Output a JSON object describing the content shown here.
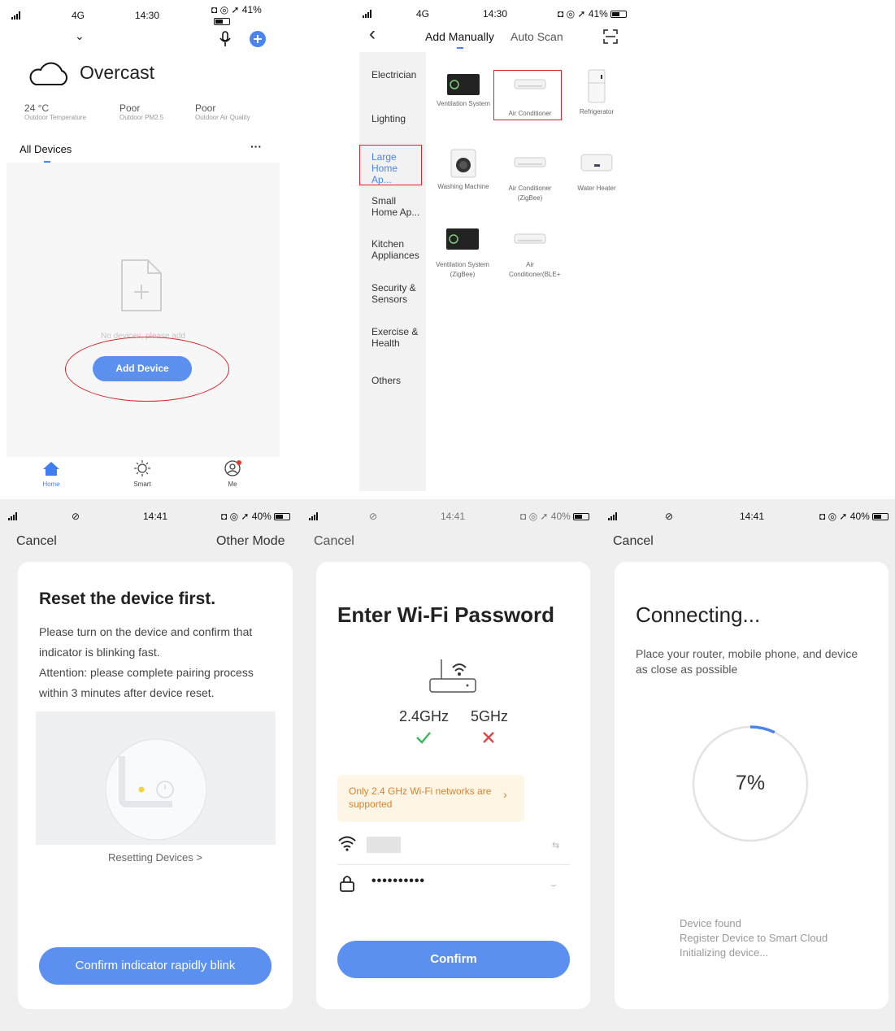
{
  "status": {
    "top_left": {
      "network": "4G",
      "time": "14:30",
      "battery": "41%"
    },
    "top_right": {
      "network": "4G",
      "time": "14:30",
      "battery": "41%"
    },
    "bottom": {
      "time": "14:41",
      "battery": "40%"
    }
  },
  "home": {
    "weather": "Overcast",
    "stats": [
      {
        "value": "24 °C",
        "label": "Outdoor Temperature"
      },
      {
        "value": "Poor",
        "label": "Outdoor PM2.5"
      },
      {
        "value": "Poor",
        "label": "Outdoor Air Quality"
      }
    ],
    "tab": "All Devices",
    "more": "···",
    "empty_text": "No devices, please add",
    "add_button": "Add Device",
    "nav": [
      {
        "label": "Home",
        "icon": "home-icon"
      },
      {
        "label": "Smart",
        "icon": "sun-icon"
      },
      {
        "label": "Me",
        "icon": "profile-icon"
      }
    ],
    "annotation_color": "#d9252b"
  },
  "add_device": {
    "back": "‹",
    "tabs": [
      "Add Manually",
      "Auto Scan"
    ],
    "categories": [
      "Electrician",
      "Lighting",
      "Large Home Ap...",
      "Small Home Ap...",
      "Kitchen Appliances",
      "Security & Sensors",
      "Exercise & Health",
      "Others"
    ],
    "devices": [
      {
        "name": "Ventilation System",
        "icon": "ventilation-icon"
      },
      {
        "name": "Air Conditioner",
        "icon": "air-conditioner-icon"
      },
      {
        "name": "Refrigerator",
        "icon": "refrigerator-icon"
      },
      {
        "name": "Washing Machine",
        "icon": "washing-machine-icon"
      },
      {
        "name": "Air Conditioner (ZigBee)",
        "icon": "air-conditioner-icon"
      },
      {
        "name": "Water Heater",
        "icon": "water-heater-icon"
      },
      {
        "name": "Ventilation System (ZigBee)",
        "icon": "ventilation-icon"
      },
      {
        "name": "Air Conditioner(BLE+",
        "icon": "air-conditioner-icon"
      }
    ]
  },
  "reset": {
    "cancel": "Cancel",
    "other_mode": "Other Mode",
    "title": "Reset the device first.",
    "body1": "Please turn on the device and confirm that indicator is blinking fast.",
    "body2": "Attention: please complete pairing process within 3 minutes after device reset.",
    "link": "Resetting Devices >",
    "button": "Confirm indicator rapidly blink"
  },
  "wifi": {
    "cancel": "Cancel",
    "title": "Enter Wi-Fi Password",
    "band1": "2.4GHz",
    "band2": "5GHz",
    "notice": "Only 2.4 GHz Wi-Fi networks are supported",
    "password_mask": "••••••••••",
    "button": "Confirm"
  },
  "connecting": {
    "cancel": "Cancel",
    "title": "Connecting...",
    "subtitle": "Place your router, mobile phone, and device as close as possible",
    "progress": 0.07,
    "progress_label": "7%",
    "steps": [
      "Device found",
      "Register Device to Smart Cloud",
      "Initializing device..."
    ]
  }
}
